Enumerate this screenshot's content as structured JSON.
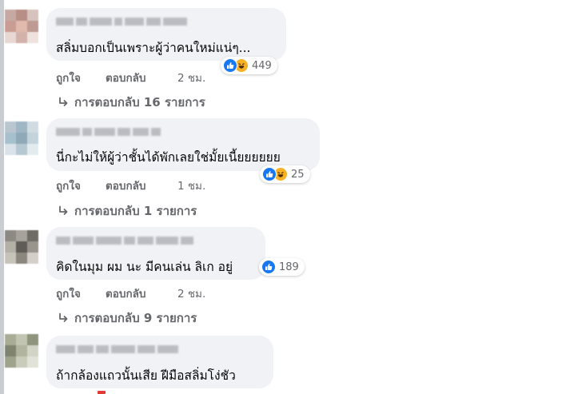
{
  "colors": {
    "bubble_bg": "#f0f2f5",
    "secondary_text": "#65676b",
    "like_blue": "#1877f2",
    "haha_yellow": "#f7b125"
  },
  "comments": [
    {
      "text": "สลิ่มบอกเป็นเพราะผู้ว่าคนใหม่แน่ๆ...",
      "reactions": [
        "like-icon",
        "haha-icon"
      ],
      "reaction_count": "449",
      "like_label": "ถูกใจ",
      "reply_label": "ตอบกลับ",
      "time": "2 ชม.",
      "replies_label": "การตอบกลับ 16 รายการ"
    },
    {
      "text": "นี่กะไม่ให้ผู้ว่าชั้นได้พักเลยใช่มั้ยเนี้ยยยยยย",
      "reactions": [
        "like-icon",
        "haha-icon"
      ],
      "reaction_count": "25",
      "like_label": "ถูกใจ",
      "reply_label": "ตอบกลับ",
      "time": "1 ชม.",
      "replies_label": "การตอบกลับ 1 รายการ"
    },
    {
      "text": "คิดในมุม ผม นะ มีคนเล่น ลิเก อยู่",
      "reactions": [
        "like-icon"
      ],
      "reaction_count": "189",
      "like_label": "ถูกใจ",
      "reply_label": "ตอบกลับ",
      "time": "2 ชม.",
      "replies_label": "การตอบกลับ 9 รายการ"
    },
    {
      "text": "ถ้ากล้องแถวนั้นเสีย ฝีมือสลิ่มโง่ชัว",
      "reactions": [],
      "reaction_count": "",
      "like_label": "",
      "reply_label": "",
      "time": "",
      "replies_label": ""
    }
  ]
}
